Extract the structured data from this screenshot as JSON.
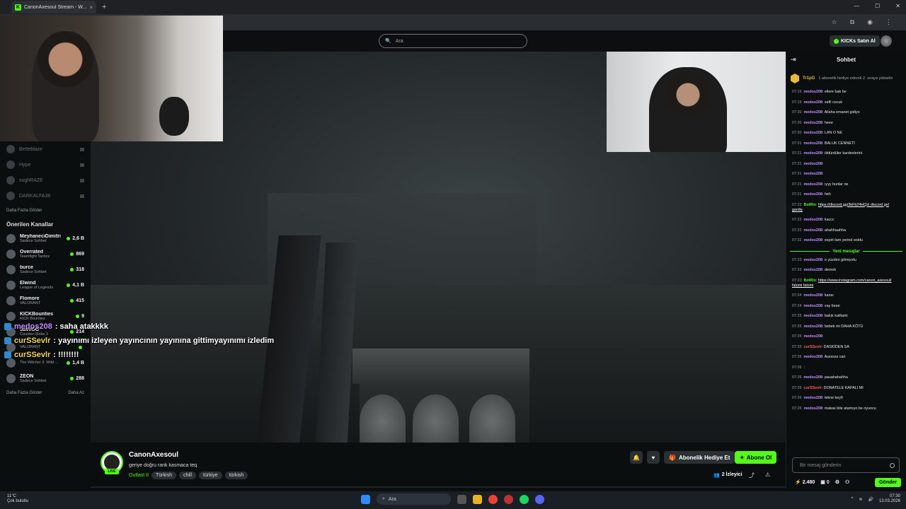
{
  "browser": {
    "tab_title": "CanonAxesoul Stream - W...",
    "new_tab": "+",
    "close_tab": "×"
  },
  "header": {
    "search_placeholder": "Ara",
    "buy_ai_label": "KICKs Satın Al"
  },
  "sidebar": {
    "followed": [
      {
        "name": "Betteblaze"
      },
      {
        "name": "Hype"
      },
      {
        "name": "sughRAZE"
      },
      {
        "name": "DARKALFA36"
      }
    ],
    "show_more": "Daha Fazla Göster",
    "recommended_title": "Önerilen Kanallar",
    "recommended": [
      {
        "name": "MeyhaneciDimitri",
        "category": "Sadece Sohbet",
        "viewers": "2,6 B"
      },
      {
        "name": "Overrated",
        "category": "Teamfight Tactics",
        "viewers": "869"
      },
      {
        "name": "burce",
        "category": "Sadece Sohbet",
        "viewers": "318"
      },
      {
        "name": "Elwind",
        "category": "League of Legends",
        "viewers": "4,1 B"
      },
      {
        "name": "Flomore",
        "category": "VALORANT",
        "viewers": "415"
      },
      {
        "name": "KICKBounties",
        "category": "KICK Bounties",
        "viewers": "9"
      },
      {
        "name": "SaveOG",
        "category": "Counter-Strike 2",
        "viewers": "214"
      },
      {
        "name": "",
        "category": "VALORANT",
        "viewers": ""
      },
      {
        "name": "",
        "category": "The Witcher 3: Wild ...",
        "viewers": "1,4 B"
      },
      {
        "name": "ZEON",
        "category": "Sadece Sohbet",
        "viewers": "288"
      }
    ],
    "show_more_2": "Daha Fazla Göster",
    "show_less": "Daha Az"
  },
  "overlay_chat": [
    {
      "user": "medos208",
      "text": ": saha atakkkk"
    },
    {
      "user": "curSSevlr",
      "text": ": yayınımı izleyen yayıncının yayınına gittimyayınımı izledim"
    },
    {
      "user": "curSSevlr",
      "text": ": !!!!!!!!"
    }
  ],
  "stream": {
    "channel": "CanonAxesoul",
    "title": "geriye doğru rank kasmaca teq",
    "category": "Outlast II",
    "tags": [
      "Türkish",
      "chill",
      "türkiye",
      "türkish"
    ],
    "live": "LIVE",
    "gift_sub": "Abonelik Hediye Et",
    "subscribe": "Abone Ol",
    "viewers": "2 İzleyici"
  },
  "chat": {
    "header": "Sohbet",
    "pinned_user": "Tr1pG",
    "pinned_text": "1 abonelik hediye ederek 2. sıraya yükselin",
    "new_messages": "Yeni mesajlar",
    "messages_before": [
      {
        "time": "07:19",
        "user": "medos208",
        "text": "ellere bak be",
        "color": "#c58cff"
      },
      {
        "time": "07:19",
        "user": "medos208",
        "text": "sefil cocuk",
        "color": "#c58cff"
      },
      {
        "time": "07:20",
        "user": "medos208",
        "text": "Allaha emanet gidiyo",
        "color": "#c58cff"
      },
      {
        "time": "07:20",
        "user": "medos208",
        "text": "heee",
        "color": "#c58cff"
      },
      {
        "time": "07:20",
        "user": "medos208",
        "text": "LAN O NE",
        "color": "#c58cff"
      },
      {
        "time": "07:21",
        "user": "medos208",
        "text": "BALUK CENNETİ",
        "color": "#c58cff"
      },
      {
        "time": "07:21",
        "user": "medos208",
        "text": "öldürdüler kardeslerini",
        "color": "#c58cff"
      },
      {
        "time": "07:21",
        "user": "medos208",
        "text": "",
        "color": "#c58cff"
      },
      {
        "time": "07:21",
        "user": "medos208",
        "text": "",
        "color": "#c58cff"
      },
      {
        "time": "07:21",
        "user": "medos208",
        "text": "ıyyy bunlar ne",
        "color": "#c58cff"
      },
      {
        "time": "07:21",
        "user": "medos208",
        "text": "heh",
        "color": "#c58cff"
      },
      {
        "time": "07:22",
        "user": "BotRix",
        "text": "https://discord.gg/3kFb24HQzi discord gel gardiş",
        "color": "#53fc18"
      },
      {
        "time": "07:22",
        "user": "medos208",
        "text": "kaccc",
        "color": "#c58cff"
      },
      {
        "time": "07:22",
        "user": "medos208",
        "text": "ahahhaahha",
        "color": "#c58cff"
      },
      {
        "time": "07:22",
        "user": "medos208",
        "text": "espiri tam yerind eoldu",
        "color": "#c58cff"
      }
    ],
    "messages_after": [
      {
        "time": "07:23",
        "user": "medos208",
        "text": "o yüzden gitmiyofu",
        "color": "#c58cff"
      },
      {
        "time": "07:23",
        "user": "medos208",
        "text": "demek",
        "color": "#c58cff"
      },
      {
        "time": "07:23",
        "user": "BotRix",
        "text": "https://www.instagram.com/canon_axesoul/ falomi falomi",
        "color": "#53fc18"
      },
      {
        "time": "07:24",
        "user": "medos208",
        "text": "kansı",
        "color": "#c58cff"
      },
      {
        "time": "07:24",
        "user": "medos208",
        "text": "vay beee",
        "color": "#c58cff"
      },
      {
        "time": "07:25",
        "user": "medos208",
        "text": "baluk katliami",
        "color": "#c58cff"
      },
      {
        "time": "07:25",
        "user": "medos208",
        "text": "bebek mi DAHA KÖTÜ",
        "color": "#c58cff"
      },
      {
        "time": "07:25",
        "user": "medos208",
        "text": "",
        "color": "#c58cff"
      },
      {
        "time": "07:25",
        "user": "curSSevlr",
        "text": "DASKİDEN SA",
        "color": "#ff5a5a"
      },
      {
        "time": "07:26",
        "user": "medos208",
        "text": "Assssss can",
        "color": "#c58cff"
      },
      {
        "time": "07:26",
        "user": "",
        "text": "",
        "color": "#ff4747"
      },
      {
        "time": "07:26",
        "user": "medos208",
        "text": "pauahahahha",
        "color": "#c58cff"
      },
      {
        "time": "07:26",
        "user": "curSSevlr",
        "text": "DONATELE KAPALI MI",
        "color": "#ff5a5a"
      },
      {
        "time": "07:26",
        "user": "medos208",
        "text": "tekne keyfi",
        "color": "#c58cff"
      },
      {
        "time": "07:26",
        "user": "medos208",
        "text": "makas bile atamıyo be oyuncu",
        "color": "#c58cff"
      }
    ],
    "input_placeholder": "Bir mesaj gönderin",
    "points": "2.480",
    "count": "0",
    "send": "Gönder",
    "watermark": "BUNOG am"
  },
  "taskbar": {
    "temp": "11°C",
    "weather": "Çok bulutlu",
    "search": "Ara",
    "time": "07:30",
    "date": "13.03.2026"
  }
}
